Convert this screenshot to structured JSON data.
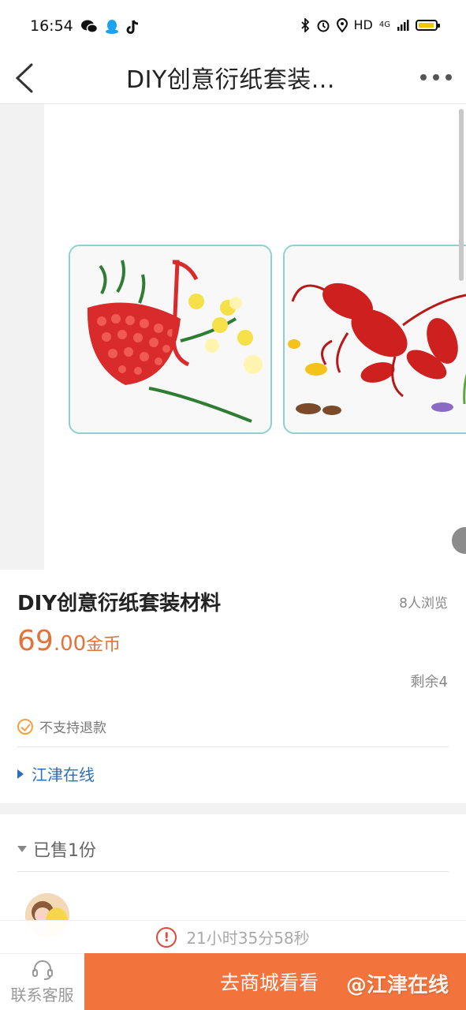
{
  "status_bar": {
    "time": "16:54",
    "network_label": "HD",
    "signal_label": "4G"
  },
  "nav": {
    "title": "DIY创意衍纸套装..."
  },
  "product": {
    "title": "DIY创意衍纸套装材料",
    "views": "8人浏览",
    "price_integer": "69",
    "price_decimal": ".00",
    "price_unit": "金币",
    "remaining": "剩余4",
    "refund_note": "不支持退款",
    "shop_name": "江津在线",
    "gallery_image_count": 2
  },
  "sold": {
    "label": "已售1份"
  },
  "countdown": {
    "icon": "!",
    "text": "21小时35分58秒"
  },
  "bottom": {
    "service_label": "联系客服",
    "mall_label": "去商城看看",
    "watermark": "@江津在线"
  },
  "colors": {
    "accent_orange": "#f2743c",
    "price_orange": "#e2733a",
    "link_blue": "#2f6fb5",
    "warning_red": "#e04a3c"
  }
}
